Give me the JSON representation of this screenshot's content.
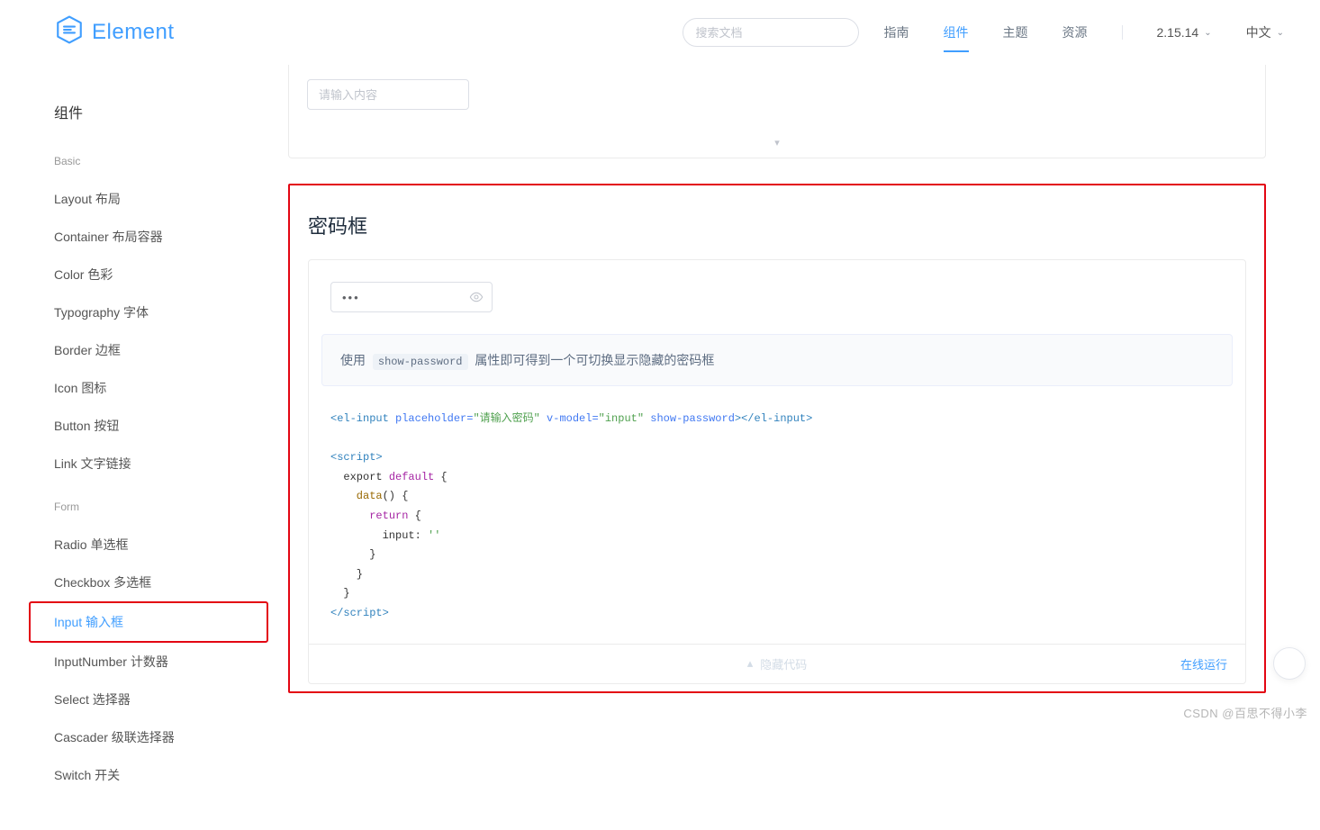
{
  "header": {
    "brand": "Element",
    "search_placeholder": "搜索文档",
    "nav": [
      "指南",
      "组件",
      "主题",
      "资源"
    ],
    "nav_active_index": 1,
    "version": "2.15.14",
    "lang": "中文"
  },
  "sidebar": {
    "title": "组件",
    "groups": [
      {
        "label": "Basic",
        "items": [
          "Layout 布局",
          "Container 布局容器",
          "Color 色彩",
          "Typography 字体",
          "Border 边框",
          "Icon 图标",
          "Button 按钮",
          "Link 文字链接"
        ]
      },
      {
        "label": "Form",
        "items": [
          "Radio 单选框",
          "Checkbox 多选框",
          "Input 输入框",
          "InputNumber 计数器",
          "Select 选择器",
          "Cascader 级联选择器",
          "Switch 开关"
        ],
        "active_index": 2
      }
    ]
  },
  "prev_demo": {
    "placeholder": "请输入内容"
  },
  "section": {
    "title": "密码框",
    "password_value": "•••",
    "desc_pre": "使用",
    "desc_code": "show-password",
    "desc_post": "属性即可得到一个可切换显示隐藏的密码框",
    "footer_center": "隐藏代码",
    "footer_right": "在线运行",
    "code": {
      "l1_open": "<el-input",
      "l1_attr1_name": " placeholder=",
      "l1_attr1_val": "\"请输入密码\"",
      "l1_attr2_name": " v-model=",
      "l1_attr2_val": "\"input\"",
      "l1_attr3_name": " show-password",
      "l1_close": "></el-input>",
      "l3": "<script>",
      "l4a": "  export ",
      "l4b": "default",
      "l4c": " {",
      "l5a": "    data",
      "l5b": "() {",
      "l6a": "      ",
      "l6b": "return",
      "l6c": " {",
      "l7a": "        input: ",
      "l7b": "''",
      "l8": "      }",
      "l9": "    }",
      "l10": "  }",
      "l11": "</script>"
    }
  },
  "watermark": "CSDN @百思不得小李"
}
